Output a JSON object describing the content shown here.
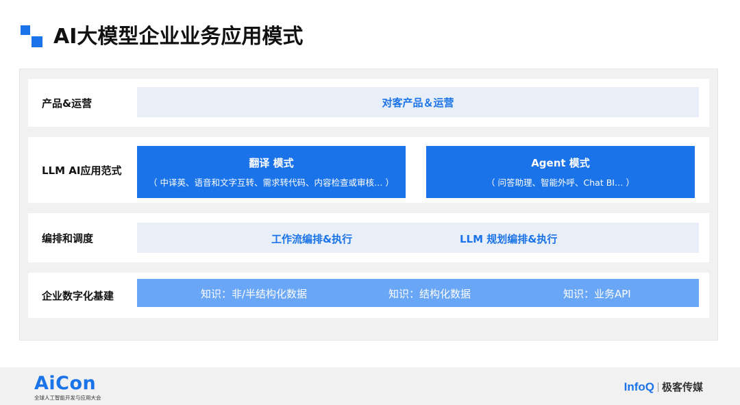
{
  "page": {
    "title": "AI大模型企业业务应用模式"
  },
  "layers": {
    "ops": {
      "label": "产品&运营",
      "bar_text": "对客产品＆运营"
    },
    "llm": {
      "label": "LLM AI应用范式",
      "translate": {
        "title": "翻译 模式",
        "sub": "（ 中译英、语音和文字互转、需求转代码、内容检查或审核… ）"
      },
      "agent": {
        "title": "Agent 模式",
        "sub": "（ 问答助理、智能外呼、Chat BI… ）"
      }
    },
    "orchestration": {
      "label": "编排和调度",
      "item1": "工作流编排&执行",
      "item2": "LLM 规划编排&执行"
    },
    "infra": {
      "label": "企业数字化基建",
      "item1": "知识：非/半结构化数据",
      "item2": "知识：结构化数据",
      "item3": "知识：业务API"
    }
  },
  "footer": {
    "aicon": "AiCon",
    "aicon_sub": "全球人工智能开发与应用大会",
    "infoq": "InfoQ",
    "infoq_cn": "极客传媒"
  },
  "colors": {
    "accent": "#1a73e8",
    "light_bar": "#e9eff9",
    "mid_bar": "#6aa6f6",
    "panel": "#f1f1f1"
  }
}
